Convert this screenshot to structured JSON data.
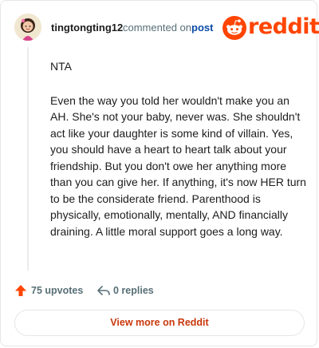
{
  "header": {
    "username": "tingtongting12",
    "commented_text": "commented on",
    "post_link": "post",
    "logo_text": "reddit"
  },
  "comment": {
    "paragraphs": [
      "NTA",
      "Even the way you told her wouldn't make you an AH. She's not your baby, never was. She shouldn't act like your daughter is some kind of villain. Yes, you should have a heart to heart talk about your friendship. But you don't owe her anything more than you can give her. If anything, it's now HER turn to be the considerate friend. Parenthood is physically, emotionally, mentally, AND financially draining. A little moral support goes a long way."
    ]
  },
  "footer": {
    "upvotes": "75 upvotes",
    "replies": "0 replies",
    "view_more": "View more on Reddit"
  },
  "colors": {
    "brand": "#ff4500",
    "link": "#0a4aa6",
    "muted": "#576f76",
    "button_text": "#c9380d"
  },
  "icons": {
    "avatar": "user-avatar",
    "logo": "reddit-snoo-icon",
    "upvote": "upvote-arrow-icon",
    "reply": "reply-arrow-icon"
  }
}
